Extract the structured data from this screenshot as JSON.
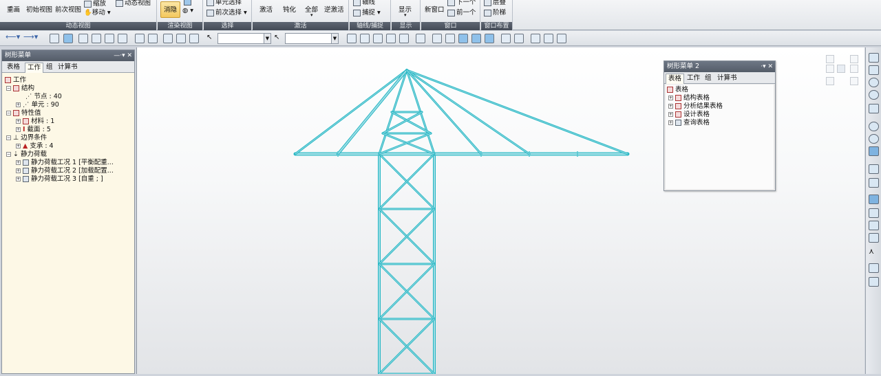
{
  "ribbon": {
    "groups": [
      {
        "label": "动态视图",
        "buttons": [
          "重画",
          "初始视图",
          "前次视图",
          "缩放",
          "移动",
          "动态视图"
        ]
      },
      {
        "label": "渲染视图",
        "buttons": [
          "消隐"
        ]
      },
      {
        "label": "选择",
        "buttons": [
          "单元选择",
          "前次选择"
        ]
      },
      {
        "label": "激活",
        "buttons": [
          "激活",
          "钝化",
          "全部",
          "逆激活"
        ]
      },
      {
        "label": "轴线/捕捉",
        "buttons": [
          "轴线",
          "捕捉"
        ]
      },
      {
        "label": "显示",
        "buttons": [
          "显示"
        ]
      },
      {
        "label": "窗口",
        "buttons": [
          "新窗口",
          "下一个",
          "前一个"
        ]
      },
      {
        "label": "窗口布置",
        "buttons": [
          "层叠",
          "阶梯"
        ]
      }
    ]
  },
  "tree_panel": {
    "title": "树形菜单",
    "controls": "—‧▾ ✕",
    "tabs": [
      "表格",
      "工作",
      "组",
      "计算书"
    ],
    "active_tab": "工作",
    "items": [
      {
        "text": "工作"
      },
      {
        "text": "结构"
      },
      {
        "text": "节点 : 40"
      },
      {
        "text": "单元 : 90"
      },
      {
        "text": "特性值"
      },
      {
        "text": "材料 : 1"
      },
      {
        "text": "截面 : 5"
      },
      {
        "text": "边界条件"
      },
      {
        "text": "支承 : 4"
      },
      {
        "text": "静力荷载"
      },
      {
        "text": "静力荷载工况 1 [平衡配重..."
      },
      {
        "text": "静力荷载工况 2 [加载配置..."
      },
      {
        "text": "静力荷载工况 3 [自重 ; ]"
      }
    ]
  },
  "float_panel": {
    "title": "树形菜单 2",
    "controls": "‧▾ ✕",
    "tabs": [
      "表格",
      "工作",
      "组",
      "计算书"
    ],
    "active_tab": "表格",
    "items": [
      "表格",
      "结构表格",
      "分析结果表格",
      "设计表格",
      "查询表格"
    ]
  },
  "model": {
    "line_color": "#22b6c3",
    "tube_color": "#9fdde5"
  }
}
